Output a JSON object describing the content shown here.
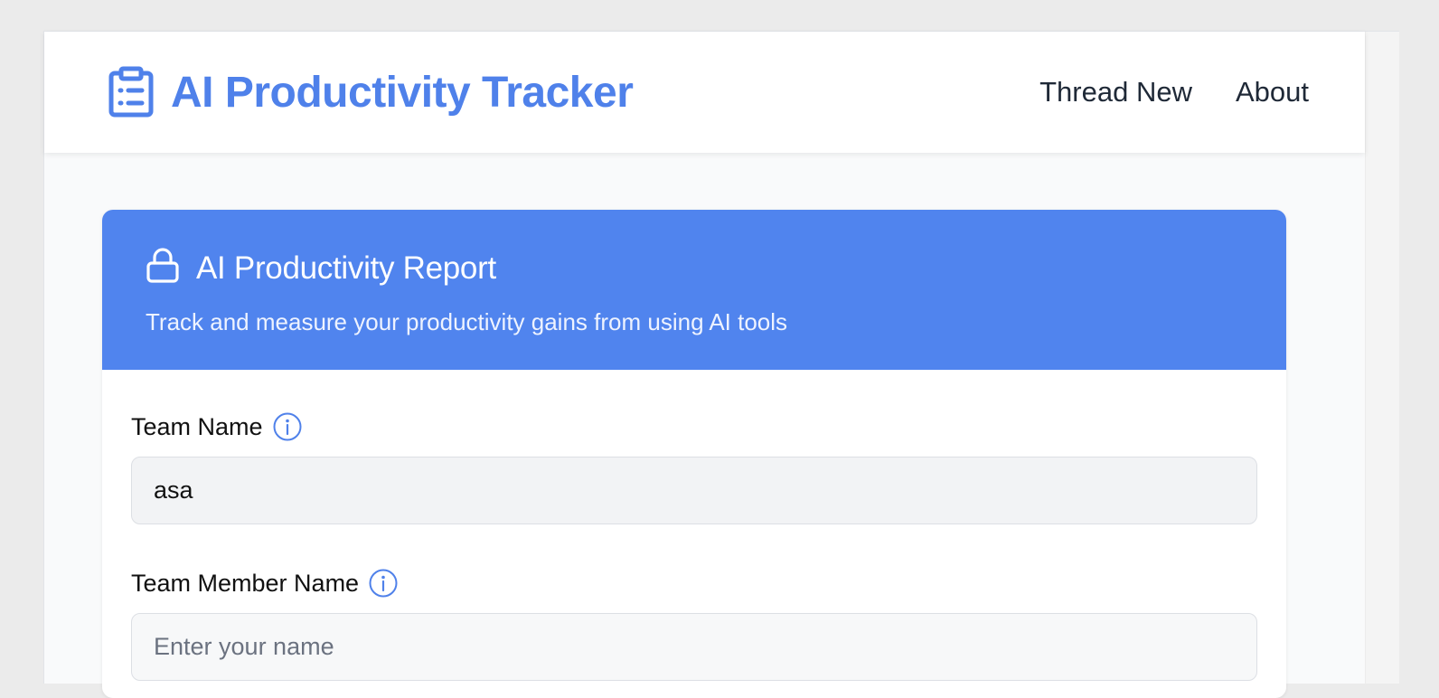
{
  "app": {
    "title": "AI Productivity Tracker",
    "brand_icon": "clipboard-list-icon",
    "accent_color": "#4f81ea"
  },
  "nav": {
    "links": [
      {
        "label": "Thread New"
      },
      {
        "label": "About"
      }
    ]
  },
  "report": {
    "icon": "lock-icon",
    "title": "AI Productivity Report",
    "subtitle": "Track and measure your productivity gains from using AI tools",
    "header_color": "#5084ee"
  },
  "form": {
    "team_name": {
      "label": "Team Name",
      "value": "asa",
      "info_icon": "info-icon"
    },
    "team_member_name": {
      "label": "Team Member Name",
      "value": "",
      "placeholder": "Enter your name",
      "info_icon": "info-icon"
    }
  }
}
